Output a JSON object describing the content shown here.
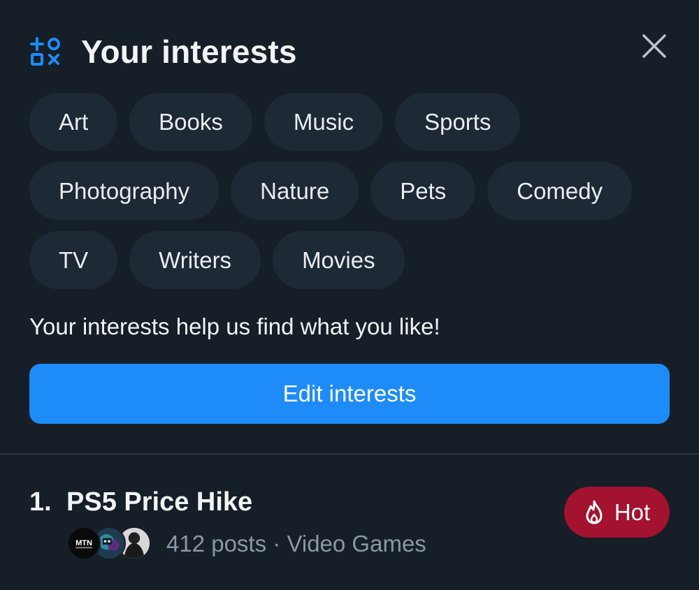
{
  "header": {
    "title": "Your interests",
    "icon": "shapes-icon",
    "close_icon": "close-icon"
  },
  "interests": [
    [
      "Art",
      "Books",
      "Music",
      "Sports"
    ],
    [
      "Photography",
      "Nature",
      "Pets",
      "Comedy"
    ],
    [
      "TV",
      "Writers",
      "Movies"
    ]
  ],
  "hint_text": "Your interests help us find what you like!",
  "edit_button_label": "Edit interests",
  "colors": {
    "background": "#161e27",
    "chip": "#1e2936",
    "accent": "#1d8cf8",
    "hot": "#a3122f"
  },
  "trending": [
    {
      "rank": "1.",
      "title": "PS5 Price Hike",
      "posts": "412 posts",
      "separator": "·",
      "category": "Video Games",
      "badge": "Hot",
      "badge_icon": "flame-icon",
      "avatars": [
        "MTN",
        "",
        ""
      ]
    }
  ]
}
